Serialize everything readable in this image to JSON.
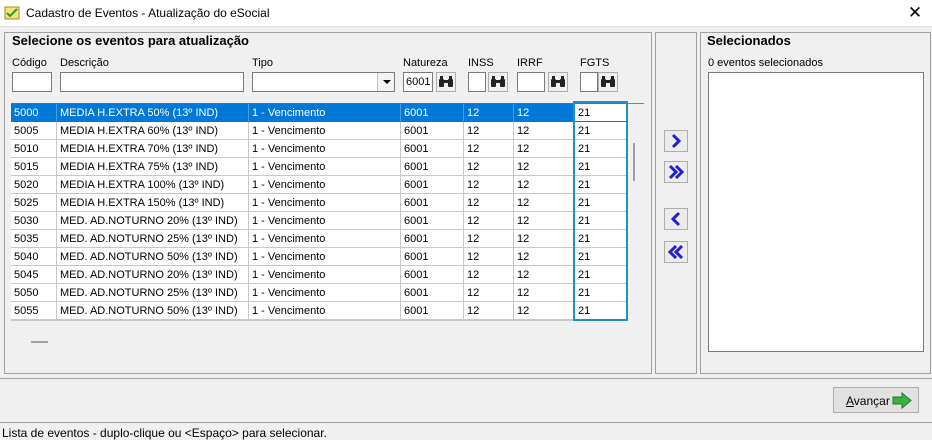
{
  "window": {
    "title": "Cadastro de Eventos - Atualização do eSocial"
  },
  "left_panel": {
    "title": "Selecione os eventos para atualização",
    "filters": {
      "codigo": {
        "label": "Código",
        "value": ""
      },
      "descricao": {
        "label": "Descrição",
        "value": ""
      },
      "tipo": {
        "label": "Tipo",
        "value": ""
      },
      "natureza": {
        "label": "Natureza",
        "value": "6001"
      },
      "inss": {
        "label": "INSS",
        "value": ""
      },
      "irrf": {
        "label": "IRRF",
        "value": ""
      },
      "fgts": {
        "label": "FGTS",
        "value": ""
      }
    },
    "rows": [
      {
        "codigo": "5000",
        "descricao": "MEDIA H.EXTRA 50% (13º IND)",
        "tipo": "1 - Vencimento",
        "natureza": "6001",
        "inss": "12",
        "irrf": "12",
        "fgts": "21",
        "selected": true
      },
      {
        "codigo": "5005",
        "descricao": "MEDIA H.EXTRA 60% (13º IND)",
        "tipo": "1 - Vencimento",
        "natureza": "6001",
        "inss": "12",
        "irrf": "12",
        "fgts": "21"
      },
      {
        "codigo": "5010",
        "descricao": "MEDIA H.EXTRA 70% (13º IND)",
        "tipo": "1 - Vencimento",
        "natureza": "6001",
        "inss": "12",
        "irrf": "12",
        "fgts": "21"
      },
      {
        "codigo": "5015",
        "descricao": "MEDIA H.EXTRA 75% (13º IND)",
        "tipo": "1 - Vencimento",
        "natureza": "6001",
        "inss": "12",
        "irrf": "12",
        "fgts": "21"
      },
      {
        "codigo": "5020",
        "descricao": "MEDIA H.EXTRA 100% (13º IND)",
        "tipo": "1 - Vencimento",
        "natureza": "6001",
        "inss": "12",
        "irrf": "12",
        "fgts": "21"
      },
      {
        "codigo": "5025",
        "descricao": "MEDIA H.EXTRA 150% (13º IND)",
        "tipo": "1 - Vencimento",
        "natureza": "6001",
        "inss": "12",
        "irrf": "12",
        "fgts": "21"
      },
      {
        "codigo": "5030",
        "descricao": "MED. AD.NOTURNO 20% (13º IND)",
        "tipo": "1 - Vencimento",
        "natureza": "6001",
        "inss": "12",
        "irrf": "12",
        "fgts": "21"
      },
      {
        "codigo": "5035",
        "descricao": "MED. AD.NOTURNO 25%  (13º IND)",
        "tipo": "1 - Vencimento",
        "natureza": "6001",
        "inss": "12",
        "irrf": "12",
        "fgts": "21"
      },
      {
        "codigo": "5040",
        "descricao": "MED. AD.NOTURNO 50% (13º IND)",
        "tipo": "1 - Vencimento",
        "natureza": "6001",
        "inss": "12",
        "irrf": "12",
        "fgts": "21"
      },
      {
        "codigo": "5045",
        "descricao": "MED. AD.NOTURNO 20%  (13º IND)",
        "tipo": "1 - Vencimento",
        "natureza": "6001",
        "inss": "12",
        "irrf": "12",
        "fgts": "21"
      },
      {
        "codigo": "5050",
        "descricao": "MED. AD.NOTURNO 25% (13º IND)",
        "tipo": "1 - Vencimento",
        "natureza": "6001",
        "inss": "12",
        "irrf": "12",
        "fgts": "21"
      },
      {
        "codigo": "5055",
        "descricao": "MED. AD.NOTURNO 50% (13º IND)",
        "tipo": "1 - Vencimento",
        "natureza": "6001",
        "inss": "12",
        "irrf": "12",
        "fgts": "21"
      }
    ]
  },
  "right_panel": {
    "title": "Selecionados",
    "count_text": "0 eventos selecionados"
  },
  "buttons": {
    "next": "Avançar"
  },
  "icons": {
    "move_right": "chevron-right-icon",
    "move_all_right": "double-chevron-right-icon",
    "move_left": "chevron-left-icon",
    "move_all_left": "double-chevron-left-icon",
    "search": "binoculars-icon",
    "next": "green-arrow-right-icon"
  },
  "colors": {
    "selection": "#0078d7",
    "highlight_frame": "#1e8fc7",
    "arrow_buttons": "#2020d0",
    "next_arrow": "#3cb043"
  },
  "status": {
    "text": "Lista de eventos - duplo-clique ou <Espaço> para selecionar."
  }
}
